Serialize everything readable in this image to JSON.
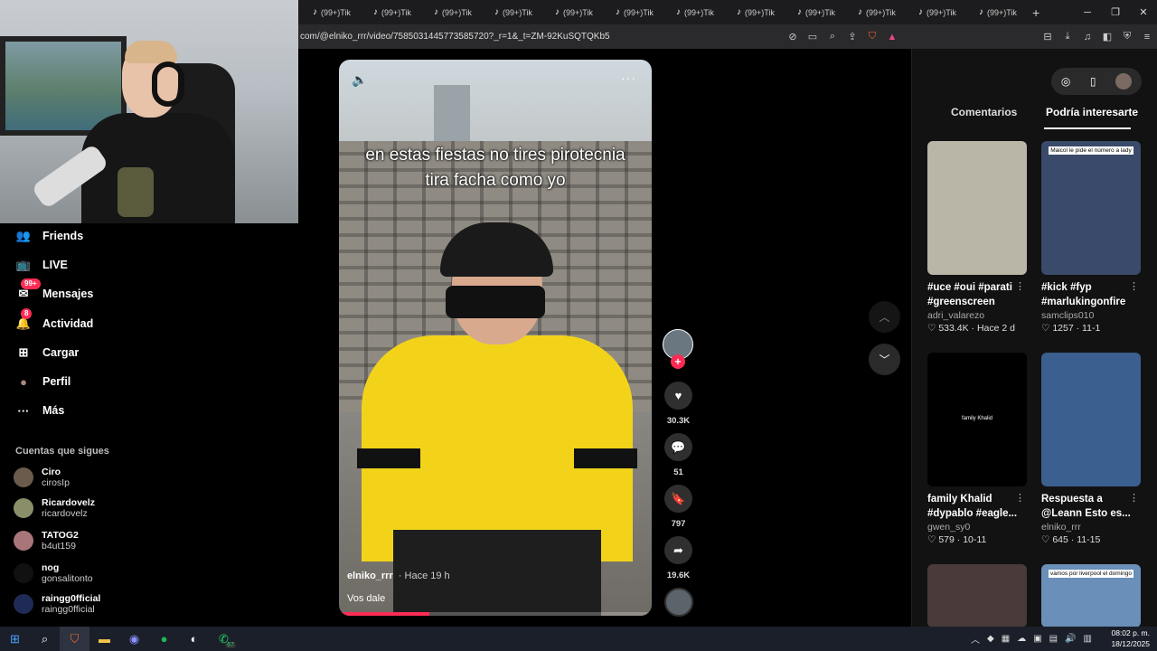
{
  "browser": {
    "tab_label": "(99+)Tik",
    "tab_count": 12,
    "new_tab": "+",
    "url": "com/@elniko_rrr/video/7585031445773585720?_r=1&_t=ZM-92KuSQTQKb5"
  },
  "sidebar": {
    "nav": [
      {
        "label": "Friends",
        "icon": "friends-icon",
        "glyph": "👥",
        "badge": ""
      },
      {
        "label": "LIVE",
        "icon": "live-icon",
        "glyph": "📺",
        "badge": ""
      },
      {
        "label": "Mensajes",
        "icon": "messages-icon",
        "glyph": "✉",
        "badge": "99+"
      },
      {
        "label": "Actividad",
        "icon": "activity-icon",
        "glyph": "🔔",
        "badge": "8"
      },
      {
        "label": "Cargar",
        "icon": "upload-icon",
        "glyph": "⊞",
        "badge": ""
      },
      {
        "label": "Perfil",
        "icon": "profile-icon",
        "glyph": "●",
        "badge": ""
      },
      {
        "label": "Más",
        "icon": "more-icon",
        "glyph": "···",
        "badge": ""
      }
    ],
    "following_heading": "Cuentas que sigues",
    "following": [
      {
        "name": "Ciro",
        "handle": "cirosIp",
        "color": "#6a5b4d"
      },
      {
        "name": "Ricardovelz",
        "handle": "ricardovelz",
        "color": "#8a8f6a"
      },
      {
        "name": "TATOG2",
        "handle": "b4ut159",
        "color": "#a8767a"
      },
      {
        "name": "nog",
        "handle": "gonsalitonto",
        "color": "#111111"
      },
      {
        "name": "raingg0fficial",
        "handle": "raingg0fficial",
        "color": "#1f2a55"
      }
    ]
  },
  "video": {
    "caption": "en estas fiestas no tires pirotecnia tira facha como yo",
    "author": "elniko_rrr",
    "time": "· Hace 19 h",
    "description": "Vos dale",
    "progress": 0.29
  },
  "actions": {
    "likes": "30.3K",
    "comments": "51",
    "saves": "797",
    "shares": "19.6K"
  },
  "right_panel": {
    "tabs": [
      "Comentarios",
      "Podría interesarte"
    ],
    "active_tab": "Podría interesarte",
    "cards": [
      {
        "title": "#uce #oui #parati #greenscreen",
        "user": "adri_valarezo",
        "likes": "533.4K",
        "date": "Hace 2 d",
        "thumb_text": "",
        "color": "#b9b6a8"
      },
      {
        "title": "#kick #fyp #marlukingonfire",
        "user": "samclips010",
        "likes": "1257",
        "date": "11-1",
        "thumb_text": "Maicol le pide el número a lady",
        "color": "#3a4a6b"
      },
      {
        "title": "family Khalid #dypablo #eagle...",
        "user": "gwen_sy0",
        "likes": "579",
        "date": "10-11",
        "thumb_text": "family Khalid",
        "color": "#000000"
      },
      {
        "title": "Respuesta a @Leann Esto es...",
        "user": "elniko_rrr",
        "likes": "645",
        "date": "11-15",
        "thumb_text": "",
        "color": "#3b5f8f"
      },
      {
        "title": "",
        "user": "",
        "likes": "",
        "date": "",
        "thumb_text": "",
        "color": "#4a3a3a"
      },
      {
        "title": "",
        "user": "",
        "likes": "",
        "date": "",
        "thumb_text": "vamos por liverpool el domingo",
        "color": "#6a8fb8"
      }
    ]
  },
  "taskbar": {
    "whatsapp_badge": "67",
    "time": "08:02 p. m.",
    "date": "18/12/2025"
  },
  "colors": {
    "accent": "#fe2c55",
    "panel": "#121212",
    "taskbar": "#1b1f29"
  }
}
